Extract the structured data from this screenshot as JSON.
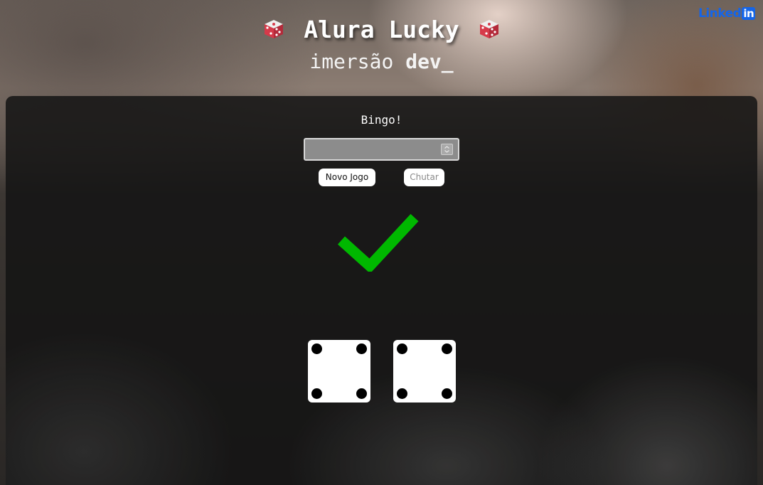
{
  "header": {
    "title": "Alura Lucky",
    "subtitle_light": "imersão",
    "subtitle_bold": "dev_",
    "title_icon": "game-die-icon"
  },
  "linkedin": {
    "text": "Linked",
    "badge": "in"
  },
  "game": {
    "status_message": "Bingo!",
    "guess_input": {
      "value": "",
      "placeholder": ""
    },
    "new_game_label": "Novo Jogo",
    "guess_label": "Chutar",
    "result_icon": "checkmark-icon",
    "result_color": "#00b800",
    "dice": [
      {
        "value": 4
      },
      {
        "value": 4
      }
    ]
  },
  "colors": {
    "linkedin_blue": "#1565e8",
    "die_red": "#d63a4a",
    "panel_bg": "#141414"
  }
}
